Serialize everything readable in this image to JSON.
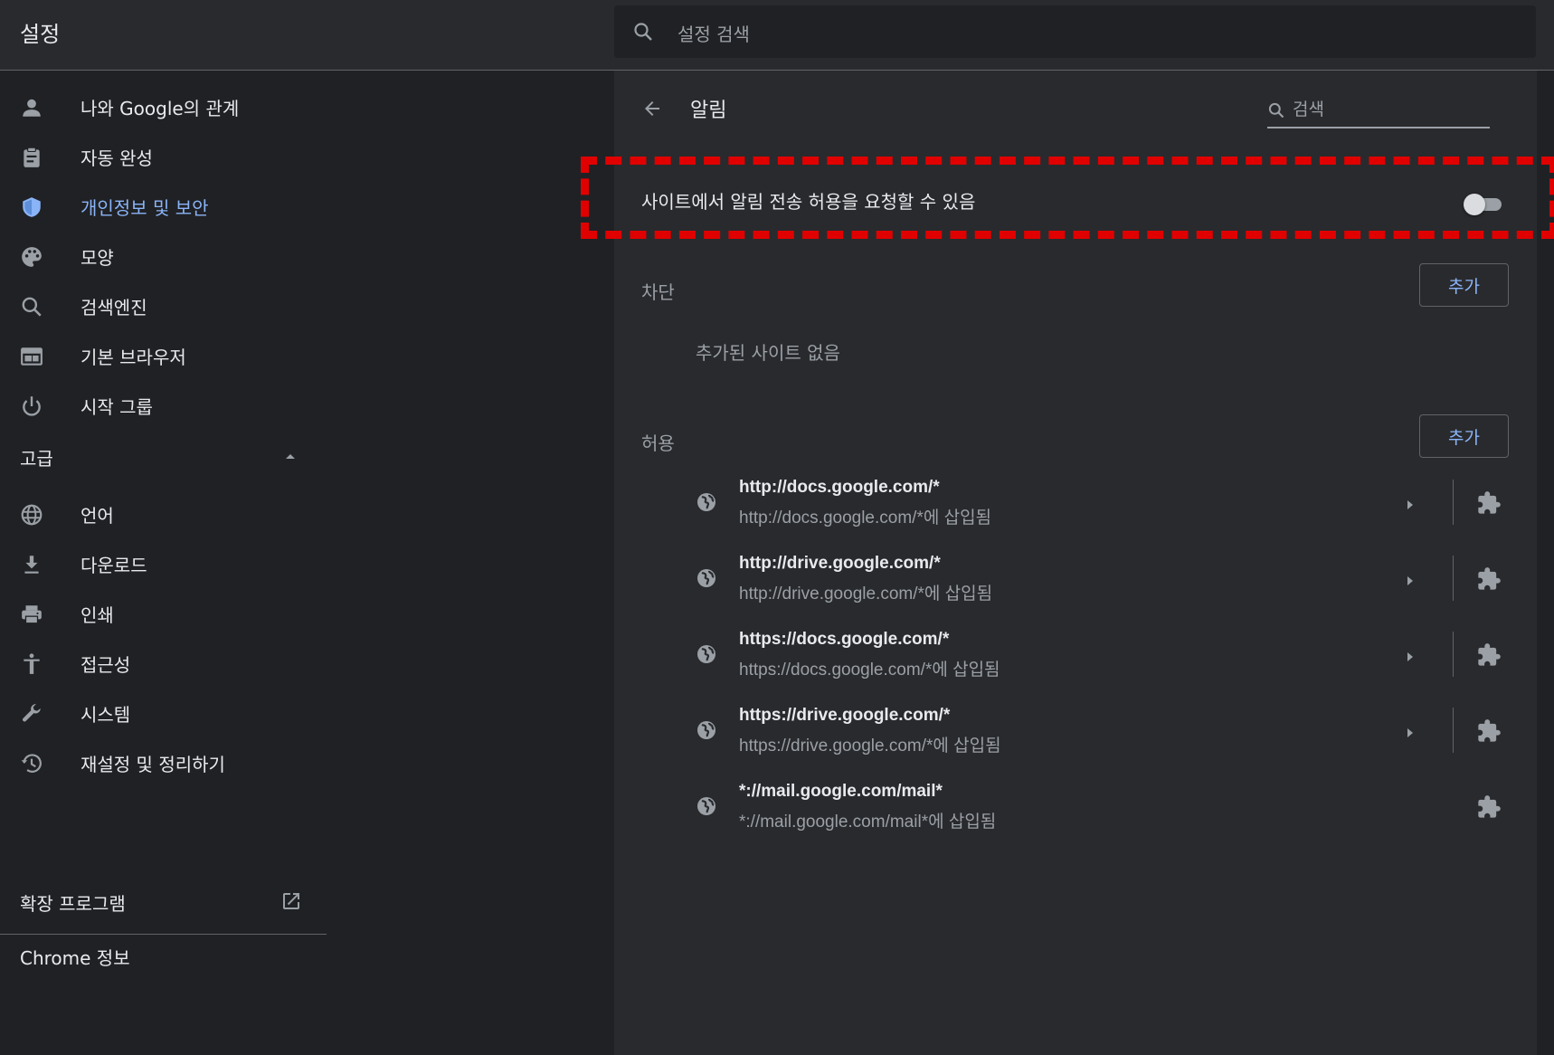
{
  "header": {
    "title": "설정",
    "search_placeholder": "설정 검색"
  },
  "sidebar": {
    "items": [
      {
        "label": "나와 Google의 관계",
        "icon": "person-icon"
      },
      {
        "label": "자동 완성",
        "icon": "clipboard-icon"
      },
      {
        "label": "개인정보 및 보안",
        "icon": "shield-icon",
        "active": true
      },
      {
        "label": "모양",
        "icon": "palette-icon"
      },
      {
        "label": "검색엔진",
        "icon": "search-icon"
      },
      {
        "label": "기본 브라우저",
        "icon": "browser-icon"
      },
      {
        "label": "시작 그룹",
        "icon": "power-icon"
      }
    ],
    "advanced_label": "고급",
    "advanced_items": [
      {
        "label": "언어",
        "icon": "globe-icon"
      },
      {
        "label": "다운로드",
        "icon": "download-icon"
      },
      {
        "label": "인쇄",
        "icon": "printer-icon"
      },
      {
        "label": "접근성",
        "icon": "accessibility-icon"
      },
      {
        "label": "시스템",
        "icon": "wrench-icon"
      },
      {
        "label": "재설정 및 정리하기",
        "icon": "history-icon"
      }
    ],
    "extensions_label": "확장 프로그램",
    "about_label": "Chrome 정보"
  },
  "main": {
    "title": "알림",
    "search_placeholder": "검색",
    "toggle_label": "사이트에서 알림 전송 허용을 요청할 수 있음",
    "toggle_on": false,
    "block_label": "차단",
    "block_add": "추가",
    "block_empty": "추가된 사이트 없음",
    "allow_label": "허용",
    "allow_add": "추가",
    "allow_sites": [
      {
        "url": "http://docs.google.com/*",
        "desc": "http://docs.google.com/*에 삽입됨",
        "expandable": true
      },
      {
        "url": "http://drive.google.com/*",
        "desc": "http://drive.google.com/*에 삽입됨",
        "expandable": true
      },
      {
        "url": "https://docs.google.com/*",
        "desc": "https://docs.google.com/*에 삽입됨",
        "expandable": true
      },
      {
        "url": "https://drive.google.com/*",
        "desc": "https://drive.google.com/*에 삽입됨",
        "expandable": true
      },
      {
        "url": "*://mail.google.com/mail*",
        "desc": "*://mail.google.com/mail*에 삽입됨",
        "expandable": false
      }
    ]
  },
  "colors": {
    "accent": "#8ab4f8",
    "highlight": "#e00000",
    "background": "#202124",
    "panel": "#292a2d"
  }
}
